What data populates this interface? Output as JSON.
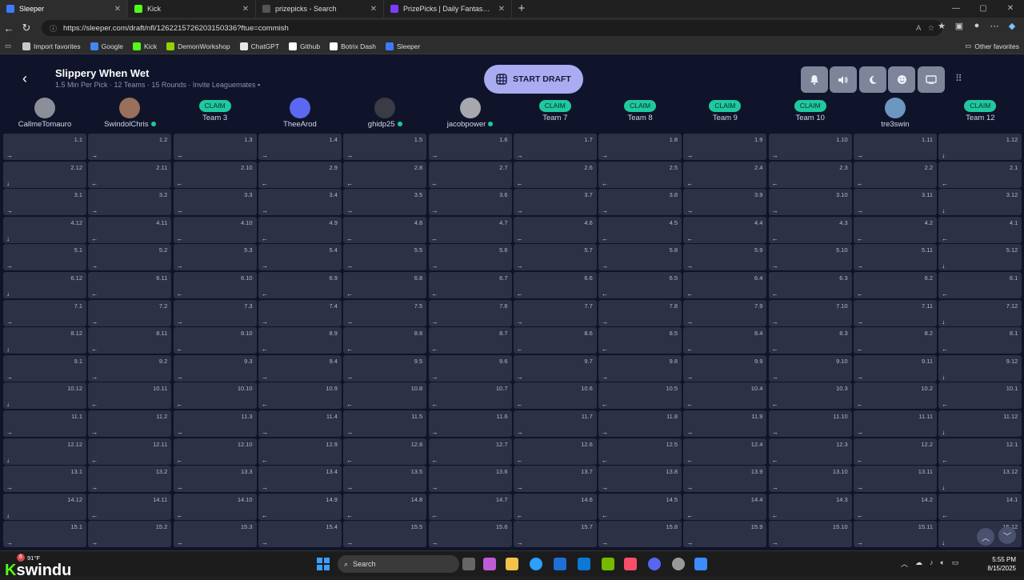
{
  "browser": {
    "tabs": [
      {
        "title": "Sleeper",
        "active": true,
        "icon": "sleeper-icon",
        "color": "#3b7cff"
      },
      {
        "title": "Kick",
        "active": false,
        "icon": "kick-icon",
        "color": "#53fc18"
      },
      {
        "title": "prizepicks - Search",
        "active": false,
        "icon": "search-icon",
        "color": "#555555"
      },
      {
        "title": "PrizePicks | Daily Fantasy Sports M",
        "active": false,
        "icon": "prizepicks-icon",
        "color": "#7d3cff"
      }
    ],
    "url": "https://sleeper.com/draft/nfl/1262215726203150336?ftue=commish",
    "bookmarks": [
      {
        "label": "Import favorites",
        "icon": "folder-icon",
        "color": "#c8c8c8"
      },
      {
        "label": "Google",
        "icon": "google-icon",
        "color": "#4285f4"
      },
      {
        "label": "Kick",
        "icon": "kick-icon",
        "color": "#53fc18"
      },
      {
        "label": "DemonWorkshop",
        "icon": "demon-icon",
        "color": "#8fd400"
      },
      {
        "label": "ChatGPT",
        "icon": "chatgpt-icon",
        "color": "#e6e6e6"
      },
      {
        "label": "Github",
        "icon": "github-icon",
        "color": "#ffffff"
      },
      {
        "label": "Botrix Dash",
        "icon": "botrix-icon",
        "color": "#ffffff"
      },
      {
        "label": "Sleeper",
        "icon": "sleeper-icon",
        "color": "#3b7cff"
      }
    ],
    "other_favorites": "Other favorites"
  },
  "draft": {
    "league_name": "Slippery When Wet",
    "subtitle": "1.5 Min Per Pick · 12 Teams · 15 Rounds · Invite Leaguemates",
    "start_label": "START DRAFT",
    "toolbar_icons": [
      "bell-icon",
      "volume-icon",
      "moon-icon",
      "emoji-icon",
      "tv-icon"
    ],
    "claim_label": "CLAIM",
    "teams": [
      {
        "name": "CallmeTomauro",
        "claim": false,
        "online": false
      },
      {
        "name": "SwindolChris",
        "claim": false,
        "online": true
      },
      {
        "name": "Team 3",
        "claim": true,
        "online": false
      },
      {
        "name": "TheeArod",
        "claim": false,
        "online": false
      },
      {
        "name": "ghidp25",
        "claim": false,
        "online": true
      },
      {
        "name": "jacobpower",
        "claim": false,
        "online": true
      },
      {
        "name": "Team 7",
        "claim": true,
        "online": false
      },
      {
        "name": "Team 8",
        "claim": true,
        "online": false
      },
      {
        "name": "Team 9",
        "claim": true,
        "online": false
      },
      {
        "name": "Team 10",
        "claim": true,
        "online": false
      },
      {
        "name": "tre3swin",
        "claim": false,
        "online": false
      },
      {
        "name": "Team 12",
        "claim": true,
        "online": false
      }
    ],
    "rounds": 15
  },
  "taskbar": {
    "weather": "91°F",
    "weather_badge": "6",
    "brand": "swindu",
    "search_label": "Search",
    "time": "5:55 PM",
    "date": "8/15/2025"
  }
}
